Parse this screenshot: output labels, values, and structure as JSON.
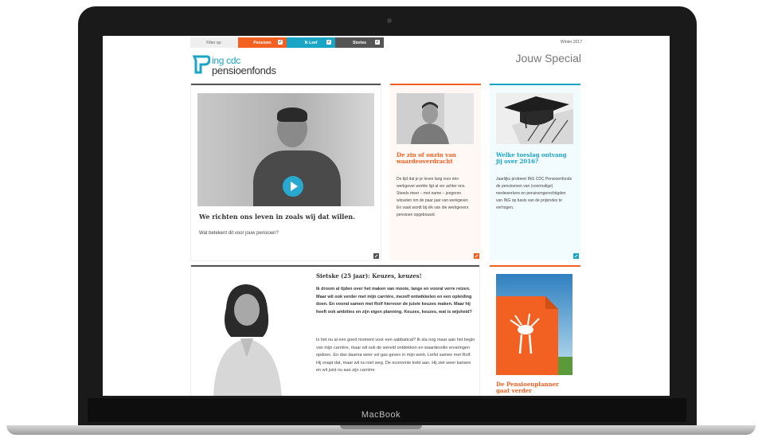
{
  "device": {
    "label": "MacBook"
  },
  "filter": {
    "label": "Filter op:",
    "buttons": [
      {
        "label": "Pensioen",
        "color": "#f26122"
      },
      {
        "label": "Ik Leef",
        "color": "#1aa4c5"
      },
      {
        "label": "Stories",
        "color": "#555555"
      }
    ],
    "checkmark": "✓"
  },
  "edition": "Winter 2017",
  "logo": {
    "top": "ing cdc",
    "bottom": "pensioenfonds"
  },
  "special_title": "Jouw Special",
  "main_card": {
    "title": "We richten ons leven in zoals wij dat willen.",
    "subtitle": "Wat betekent dit voor jouw pensioen?"
  },
  "card_orange": {
    "title": "De zin of onzin van waardeoverdracht",
    "text": "De tijd dat je je leven lang voor één werkgever werkte ligt al ver achter ons. Steeds meer – met name – jongeren wisselen om de paar jaar van werkgever. En vaak wordt bij elk van die werkgevers pensioen opgebouwd.",
    "color": "#f26122"
  },
  "card_blue": {
    "title": "Welke toeslag ontvang jij over 2016?",
    "text": "Jaarlijks probeert ING CDC Pensioenfonds de pensioenen van (voormalige) medewerkers en pensioengerechtigden van ING op basis van de prijsindex te verhogen.",
    "color": "#1aa4c5"
  },
  "sietske": {
    "title": "Sietske (25 jaar): Keuzes, keuzes!",
    "bold_text": "Ik droom al tijden over het maken van mooie, lange en vooral verre reizen. Maar wil ook verder met mijn carrière, mezelf ontwikkelen en een opleiding doen. En vooral samen met Rolf hiervoor de juiste keuzes maken. Maar hij heeft ook ambities en zijn eigen planning. Keuzes, keuzes, wat is wijsheid?",
    "text": "Is het nu al een goed moment voor een sabbatical? Ik sta nog maar aan het begin van mijn carrière, maar wil ook de wereld ontdekken en waardevolle ervaringen opdoen. En dan daarna weer vol gas geven in mijn werk. Liefst samen met Rolf. Hij snapt dat, maar wil nu niet weg. De economie trekt aan. Hij ziet weer kansen en wil juist nu aan zijn carrière"
  },
  "planner": {
    "title": "De Pensioenplanner gaat verder"
  }
}
